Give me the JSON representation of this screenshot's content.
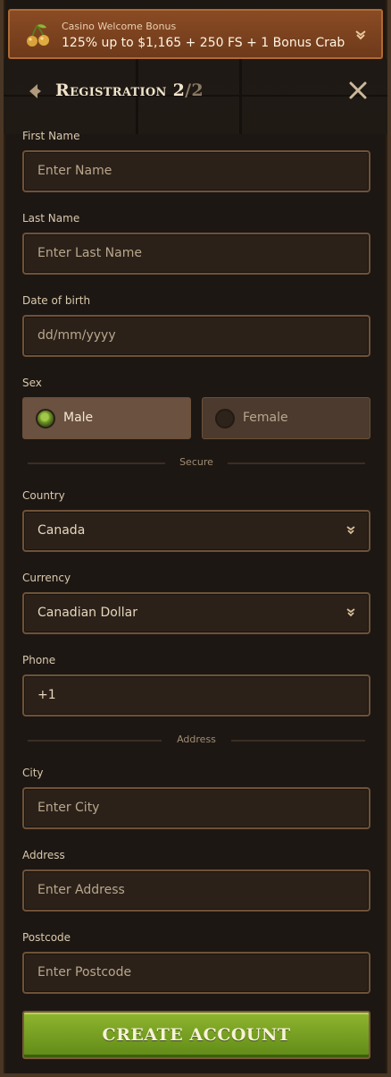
{
  "bonus": {
    "subtitle": "Casino Welcome Bonus",
    "text": "125% up to $1,165 + 250 FS + 1 Bonus Crab",
    "icon": "cherry-icon"
  },
  "header": {
    "title": "Registration 2",
    "step_sep": "/",
    "step_total": "2"
  },
  "form": {
    "first_name": {
      "label": "First Name",
      "placeholder": "Enter Name"
    },
    "last_name": {
      "label": "Last Name",
      "placeholder": "Enter Last Name"
    },
    "dob": {
      "label": "Date of birth",
      "placeholder": "dd/mm/yyyy"
    },
    "sex": {
      "label": "Sex",
      "male": "Male",
      "female": "Female",
      "selected": "Male"
    },
    "divider_secure": "Secure",
    "country": {
      "label": "Country",
      "value": "Canada"
    },
    "currency": {
      "label": "Currency",
      "value": "Canadian Dollar"
    },
    "phone": {
      "label": "Phone",
      "value": "+1"
    },
    "divider_address": "Address",
    "city": {
      "label": "City",
      "placeholder": "Enter City"
    },
    "address": {
      "label": "Address",
      "placeholder": "Enter Address"
    },
    "postcode": {
      "label": "Postcode",
      "placeholder": "Enter Postcode"
    }
  },
  "submit_label": "CREATE ACCOUNT",
  "colors": {
    "accent_green": "#6f9528",
    "bonus_bar": "#7a4220",
    "field_bg": "#2b2119",
    "field_border": "#6e5238"
  }
}
